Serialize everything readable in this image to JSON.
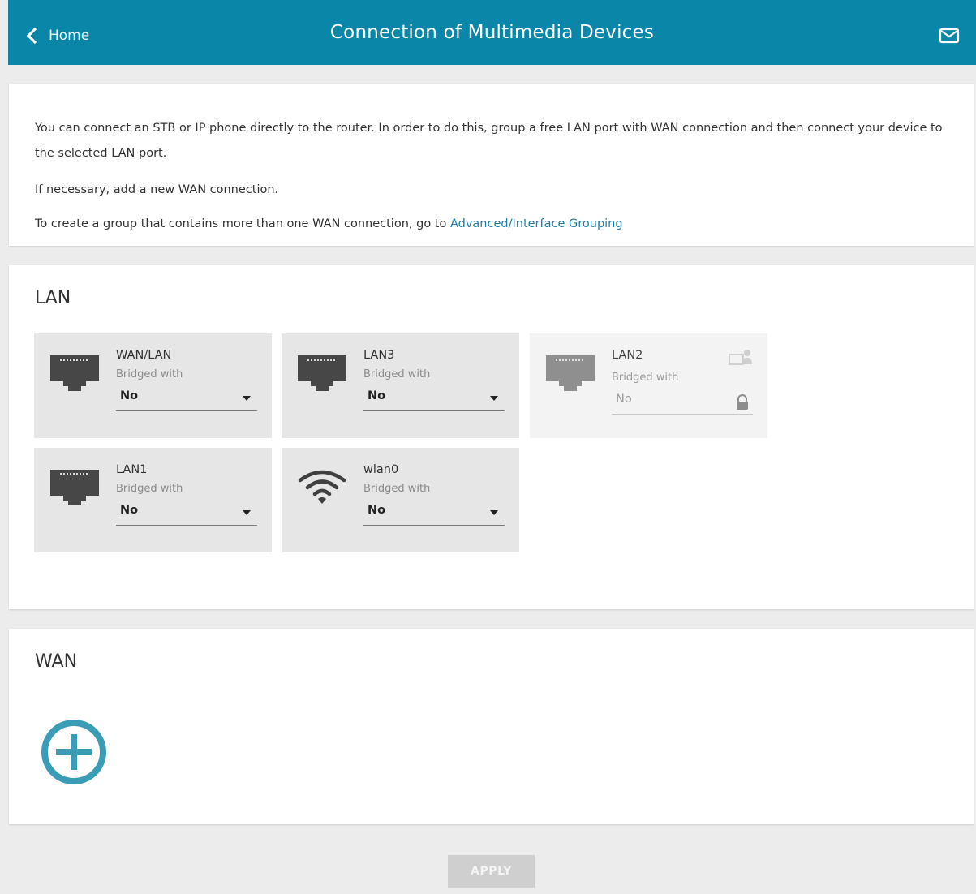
{
  "header": {
    "back_label": "Home",
    "title": "Connection of Multimedia Devices"
  },
  "intro": {
    "paragraph1": "You can connect an STB or IP phone directly to the router. In order to do this, group a free LAN port with WAN connection and then connect your device to the selected LAN port.",
    "paragraph2": "If necessary, add a new WAN connection.",
    "paragraph3_prefix": "To create a group that contains more than one WAN connection, go to ",
    "paragraph3_link": "Advanced/Interface Grouping"
  },
  "lan": {
    "title": "LAN",
    "ports": [
      {
        "name": "WAN/LAN",
        "sublabel": "Bridged with",
        "value": "No",
        "icon": "ethernet-port-icon"
      },
      {
        "name": "LAN3",
        "sublabel": "Bridged with",
        "value": "No",
        "icon": "ethernet-port-icon"
      },
      {
        "name": "LAN2",
        "sublabel": "Bridged with",
        "value": "No",
        "icon": "ethernet-port-icon",
        "disabled": true
      },
      {
        "name": "LAN1",
        "sublabel": "Bridged with",
        "value": "No",
        "icon": "ethernet-port-icon"
      },
      {
        "name": "wlan0",
        "sublabel": "Bridged with",
        "value": "No",
        "icon": "wifi-icon"
      }
    ]
  },
  "wan": {
    "title": "WAN"
  },
  "footer": {
    "apply_label": "APPLY"
  },
  "colors": {
    "header_bg": "#0a87a8",
    "accent": "#3a9db5",
    "link": "#1f7ea9"
  }
}
